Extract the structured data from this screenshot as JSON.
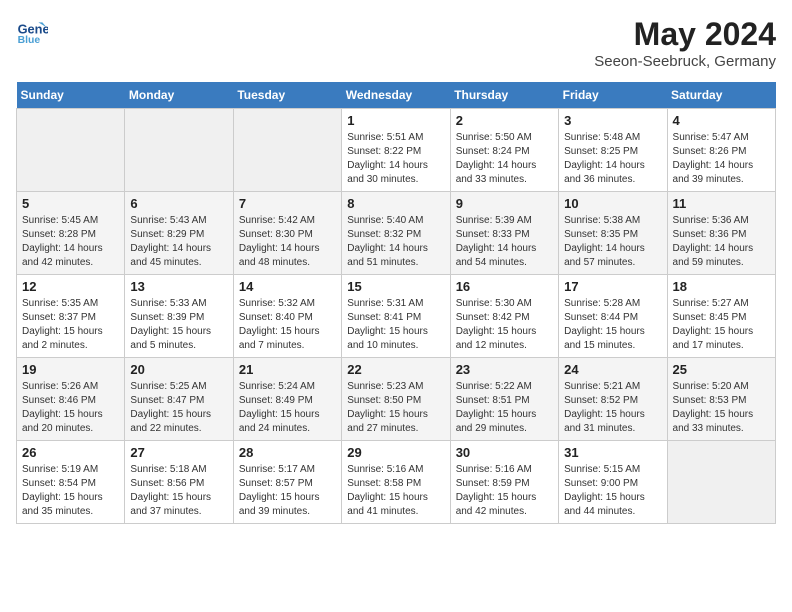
{
  "header": {
    "logo_line1": "General",
    "logo_line2": "Blue",
    "month": "May 2024",
    "location": "Seeon-Seebruck, Germany"
  },
  "weekdays": [
    "Sunday",
    "Monday",
    "Tuesday",
    "Wednesday",
    "Thursday",
    "Friday",
    "Saturday"
  ],
  "weeks": [
    [
      {
        "day": "",
        "info": ""
      },
      {
        "day": "",
        "info": ""
      },
      {
        "day": "",
        "info": ""
      },
      {
        "day": "1",
        "info": "Sunrise: 5:51 AM\nSunset: 8:22 PM\nDaylight: 14 hours and 30 minutes."
      },
      {
        "day": "2",
        "info": "Sunrise: 5:50 AM\nSunset: 8:24 PM\nDaylight: 14 hours and 33 minutes."
      },
      {
        "day": "3",
        "info": "Sunrise: 5:48 AM\nSunset: 8:25 PM\nDaylight: 14 hours and 36 minutes."
      },
      {
        "day": "4",
        "info": "Sunrise: 5:47 AM\nSunset: 8:26 PM\nDaylight: 14 hours and 39 minutes."
      }
    ],
    [
      {
        "day": "5",
        "info": "Sunrise: 5:45 AM\nSunset: 8:28 PM\nDaylight: 14 hours and 42 minutes."
      },
      {
        "day": "6",
        "info": "Sunrise: 5:43 AM\nSunset: 8:29 PM\nDaylight: 14 hours and 45 minutes."
      },
      {
        "day": "7",
        "info": "Sunrise: 5:42 AM\nSunset: 8:30 PM\nDaylight: 14 hours and 48 minutes."
      },
      {
        "day": "8",
        "info": "Sunrise: 5:40 AM\nSunset: 8:32 PM\nDaylight: 14 hours and 51 minutes."
      },
      {
        "day": "9",
        "info": "Sunrise: 5:39 AM\nSunset: 8:33 PM\nDaylight: 14 hours and 54 minutes."
      },
      {
        "day": "10",
        "info": "Sunrise: 5:38 AM\nSunset: 8:35 PM\nDaylight: 14 hours and 57 minutes."
      },
      {
        "day": "11",
        "info": "Sunrise: 5:36 AM\nSunset: 8:36 PM\nDaylight: 14 hours and 59 minutes."
      }
    ],
    [
      {
        "day": "12",
        "info": "Sunrise: 5:35 AM\nSunset: 8:37 PM\nDaylight: 15 hours and 2 minutes."
      },
      {
        "day": "13",
        "info": "Sunrise: 5:33 AM\nSunset: 8:39 PM\nDaylight: 15 hours and 5 minutes."
      },
      {
        "day": "14",
        "info": "Sunrise: 5:32 AM\nSunset: 8:40 PM\nDaylight: 15 hours and 7 minutes."
      },
      {
        "day": "15",
        "info": "Sunrise: 5:31 AM\nSunset: 8:41 PM\nDaylight: 15 hours and 10 minutes."
      },
      {
        "day": "16",
        "info": "Sunrise: 5:30 AM\nSunset: 8:42 PM\nDaylight: 15 hours and 12 minutes."
      },
      {
        "day": "17",
        "info": "Sunrise: 5:28 AM\nSunset: 8:44 PM\nDaylight: 15 hours and 15 minutes."
      },
      {
        "day": "18",
        "info": "Sunrise: 5:27 AM\nSunset: 8:45 PM\nDaylight: 15 hours and 17 minutes."
      }
    ],
    [
      {
        "day": "19",
        "info": "Sunrise: 5:26 AM\nSunset: 8:46 PM\nDaylight: 15 hours and 20 minutes."
      },
      {
        "day": "20",
        "info": "Sunrise: 5:25 AM\nSunset: 8:47 PM\nDaylight: 15 hours and 22 minutes."
      },
      {
        "day": "21",
        "info": "Sunrise: 5:24 AM\nSunset: 8:49 PM\nDaylight: 15 hours and 24 minutes."
      },
      {
        "day": "22",
        "info": "Sunrise: 5:23 AM\nSunset: 8:50 PM\nDaylight: 15 hours and 27 minutes."
      },
      {
        "day": "23",
        "info": "Sunrise: 5:22 AM\nSunset: 8:51 PM\nDaylight: 15 hours and 29 minutes."
      },
      {
        "day": "24",
        "info": "Sunrise: 5:21 AM\nSunset: 8:52 PM\nDaylight: 15 hours and 31 minutes."
      },
      {
        "day": "25",
        "info": "Sunrise: 5:20 AM\nSunset: 8:53 PM\nDaylight: 15 hours and 33 minutes."
      }
    ],
    [
      {
        "day": "26",
        "info": "Sunrise: 5:19 AM\nSunset: 8:54 PM\nDaylight: 15 hours and 35 minutes."
      },
      {
        "day": "27",
        "info": "Sunrise: 5:18 AM\nSunset: 8:56 PM\nDaylight: 15 hours and 37 minutes."
      },
      {
        "day": "28",
        "info": "Sunrise: 5:17 AM\nSunset: 8:57 PM\nDaylight: 15 hours and 39 minutes."
      },
      {
        "day": "29",
        "info": "Sunrise: 5:16 AM\nSunset: 8:58 PM\nDaylight: 15 hours and 41 minutes."
      },
      {
        "day": "30",
        "info": "Sunrise: 5:16 AM\nSunset: 8:59 PM\nDaylight: 15 hours and 42 minutes."
      },
      {
        "day": "31",
        "info": "Sunrise: 5:15 AM\nSunset: 9:00 PM\nDaylight: 15 hours and 44 minutes."
      },
      {
        "day": "",
        "info": ""
      }
    ]
  ]
}
